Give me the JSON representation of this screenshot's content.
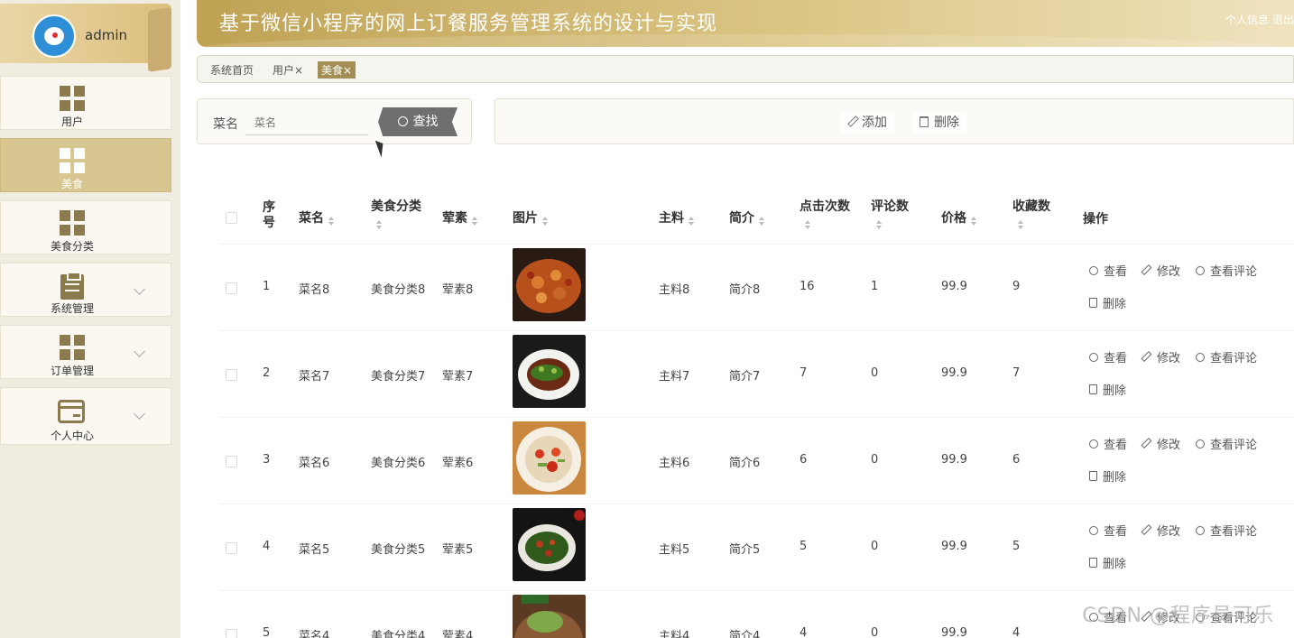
{
  "sidebar": {
    "username": "admin",
    "items": [
      {
        "label": "用户",
        "icon": "grid-icon"
      },
      {
        "label": "美食",
        "icon": "grid-icon"
      },
      {
        "label": "美食分类",
        "icon": "grid-icon"
      },
      {
        "label": "系统管理",
        "icon": "clipboard-icon"
      },
      {
        "label": "订单管理",
        "icon": "grid-icon"
      },
      {
        "label": "个人中心",
        "icon": "card-icon"
      }
    ]
  },
  "header": {
    "title": "基于微信小程序的网上订餐服务管理系统的设计与实现",
    "profile_link": "个人信息",
    "logout_link": "退出"
  },
  "tabs": [
    "系统首页",
    "用户×",
    "美食×"
  ],
  "search": {
    "label": "菜名",
    "placeholder": "菜名",
    "button": "查找"
  },
  "actions": {
    "add": "添加",
    "delete": "删除"
  },
  "table": {
    "headers": {
      "index": "序号",
      "name": "菜名",
      "category": "美食分类",
      "meat": "荤素",
      "image": "图片",
      "main": "主料",
      "intro": "简介",
      "clicks": "点击次数",
      "comments": "评论数",
      "price": "价格",
      "favorites": "收藏数",
      "ops": "操作"
    },
    "ops": {
      "view": "查看",
      "edit": "修改",
      "view_comments": "查看评论",
      "delete": "删除"
    },
    "rows": [
      {
        "index": "1",
        "name": "菜名8",
        "category": "美食分类8",
        "meat": "荤素8",
        "main": "主料8",
        "intro": "简介8",
        "clicks": "16",
        "comments": "1",
        "price": "99.9",
        "favorites": "9"
      },
      {
        "index": "2",
        "name": "菜名7",
        "category": "美食分类7",
        "meat": "荤素7",
        "main": "主料7",
        "intro": "简介7",
        "clicks": "7",
        "comments": "0",
        "price": "99.9",
        "favorites": "7"
      },
      {
        "index": "3",
        "name": "菜名6",
        "category": "美食分类6",
        "meat": "荤素6",
        "main": "主料6",
        "intro": "简介6",
        "clicks": "6",
        "comments": "0",
        "price": "99.9",
        "favorites": "6"
      },
      {
        "index": "4",
        "name": "菜名5",
        "category": "美食分类5",
        "meat": "荤素5",
        "main": "主料5",
        "intro": "简介5",
        "clicks": "5",
        "comments": "0",
        "price": "99.9",
        "favorites": "5"
      },
      {
        "index": "5",
        "name": "菜名4",
        "category": "美食分类4",
        "meat": "荤素4",
        "main": "主料4",
        "intro": "简介4",
        "clicks": "4",
        "comments": "0",
        "price": "99.9",
        "favorites": "4"
      }
    ]
  },
  "watermark": "CSDN @程序员可乐",
  "colors": {
    "accent": "#a38e55",
    "header_start": "#bfa254",
    "sidebar_bg": "#f1ece2"
  }
}
